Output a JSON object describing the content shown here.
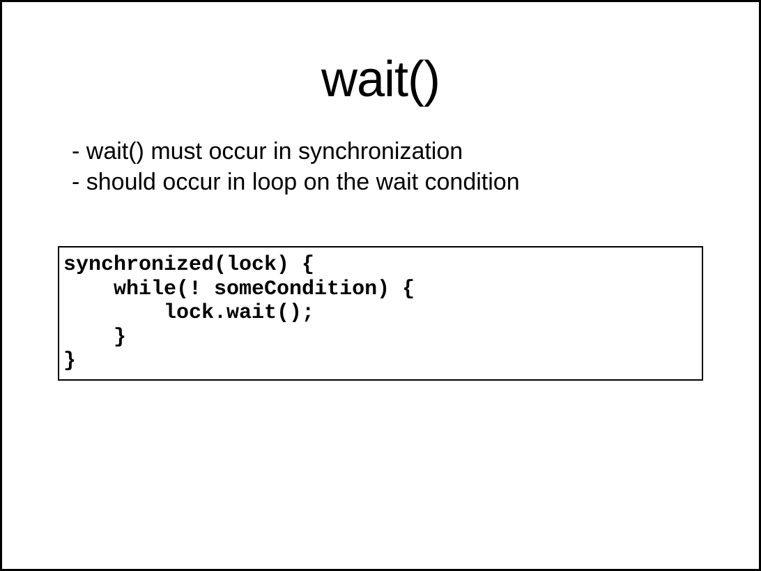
{
  "title": "wait()",
  "bullets": [
    "- wait() must occur in synchronization",
    "- should occur in loop on the wait condition"
  ],
  "code": "synchronized(lock) {\n    while(! someCondition) {\n        lock.wait();\n    }\n}"
}
